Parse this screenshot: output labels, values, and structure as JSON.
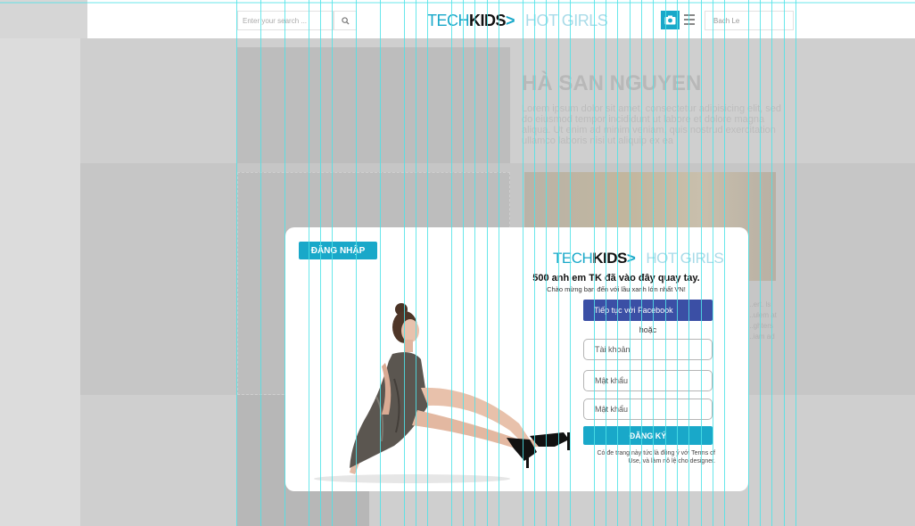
{
  "header": {
    "search_placeholder": "Enter your search ...",
    "logo_tech": "TECH",
    "logo_kids": "KIDS",
    "logo_arrow": ">",
    "logo_hot": "HOT GIRLS",
    "user_name": "Bach Le"
  },
  "profile": {
    "name": "HÀ SAN NGUYEN",
    "description": "Lorem ipsum dolor sit amet, consectetur adipisicing elit, sed do eiusmod tempor incididunt ut labore et dolore magna aliqua. Ut enim ad minim veniam, quis nostrud exercitation ullamco laboris nisi ut aliquip ex ea"
  },
  "card_snippet": "...ert. ls ...ulem at ...ghters ...iam ad",
  "modal": {
    "login_label": "ĐĂNG NHẬP",
    "logo_tech": "TECH",
    "logo_kids": "KIDS",
    "logo_arrow": ">",
    "logo_hot": "HOT GIRLS",
    "headline": "500 anh em TK đã vào đây quay tay.",
    "subline": "Chào mừng bạn đến với lầu xanh lớn nhất VN!",
    "facebook_label": "Tiếp tục với Facebook",
    "or_label": "hoặc",
    "username_placeholder": "Tài khoản",
    "password_placeholder": "Mật khẩu",
    "confirm_placeholder": "Mật khẩu",
    "signup_label": "ĐĂNG KÝ",
    "terms": "Có đe trang này tức là đồng ý với Terms of Use, và làm nô lệ cho designer."
  },
  "colors": {
    "accent": "#19a8c9",
    "facebook": "#3b4fa5",
    "guide": "#4fe3e8"
  }
}
